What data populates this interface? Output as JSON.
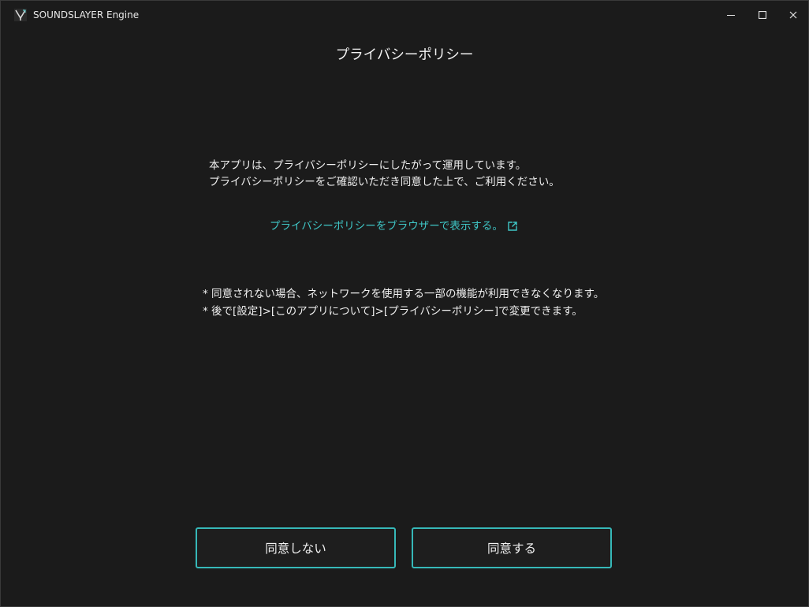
{
  "window": {
    "app_title": "SOUNDSLAYER Engine"
  },
  "dialog": {
    "title": "プライバシーポリシー",
    "intro_line1": "本アプリは、プライバシーポリシーにしたがって運用しています。",
    "intro_line2": "プライバシーポリシーをご確認いただき同意した上で、ご利用ください。",
    "link_text": "プライバシーポリシーをブラウザーで表示する。",
    "note1": "* 同意されない場合、ネットワークを使用する一部の機能が利用できなくなります。",
    "note2": "* 後で[設定]>[このアプリについて]>[プライバシーポリシー]で変更できます。"
  },
  "buttons": {
    "decline_label": "同意しない",
    "agree_label": "同意する"
  },
  "icons": {
    "logo": "app-logo-icon",
    "minimize": "minimize-icon",
    "maximize": "maximize-icon",
    "close": "close-icon",
    "external_link": "external-link-icon"
  },
  "colors": {
    "background": "#1b1b1b",
    "accent": "#36b8b8",
    "link": "#3fc6c6",
    "text": "#f0f0f0"
  }
}
